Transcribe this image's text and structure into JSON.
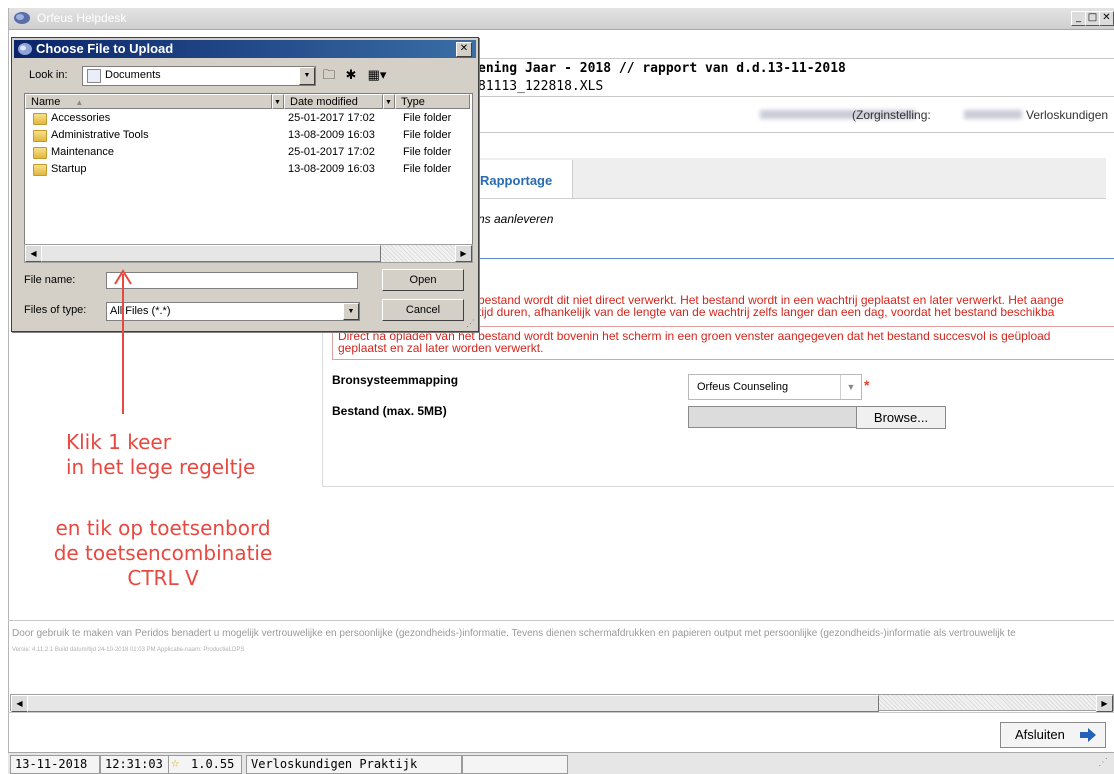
{
  "window": {
    "title": "Orfeus Helpdesk",
    "controls": [
      "_",
      "□",
      "✕"
    ]
  },
  "report": {
    "title_line": "ening Jaar - 2018 // rapport van d.d.13-11-2018",
    "file_line": "81113_122818.XLS",
    "org_prefix": "(Zorginstelling:",
    "org_suffix": "Verloskundigen"
  },
  "tabs": {
    "active_label": "Rapportage"
  },
  "upload": {
    "intro": "ns aanleveren",
    "warning_line1": "bestand wordt dit niet direct verwerkt. Het bestand wordt in een wachtrij geplaatst en later verwerkt. Het aange",
    "warning_line2": "tijd duren, afhankelijk van de lengte van de wachtrij zelfs langer dan een dag, voordat het bestand beschikba",
    "warning_line3": "Direct na opladen van het bestand wordt bovenin het scherm in een groen venster aangegeven dat het bestand succesvol is geüpload",
    "warning_line4": "geplaatst en zal later worden verwerkt.",
    "mapping_label": "Bronsysteemmapping",
    "mapping_value": "Orfeus Counseling",
    "required_mark": "*",
    "file_label": "Bestand (max. 5MB)",
    "browse_label": "Browse..."
  },
  "footer": {
    "privacy_note": "Door gebruik te maken van Peridos benadert u mogelijk vertrouwelijke en persoonlijke (gezondheids-)informatie. Tevens dienen schermafdrukken en papieren output met persoonlijke (gezondheids-)informatie als vertrouwelijk te",
    "version_note": "Versie: 4.11.2.1 Build datum/tijd 24-10-2018 01:03 PM Applicatie-naam: ProductieLDPS"
  },
  "close_button": "Afsluiten",
  "statusbar": {
    "date": "13-11-2018",
    "time": "12:31:03",
    "version": "1.0.55",
    "practice": "Verloskundigen Praktijk"
  },
  "dialog": {
    "title": "Choose File to Upload",
    "look_in_label": "Look in:",
    "look_in_value": "Documents",
    "columns": {
      "name": "Name",
      "date": "Date modified",
      "type": "Type"
    },
    "files": [
      {
        "name": "Accessories",
        "date": "25-01-2017 17:02",
        "type": "File folder"
      },
      {
        "name": "Administrative Tools",
        "date": "13-08-2009 16:03",
        "type": "File folder"
      },
      {
        "name": "Maintenance",
        "date": "25-01-2017 17:02",
        "type": "File folder"
      },
      {
        "name": "Startup",
        "date": "13-08-2009 16:03",
        "type": "File folder"
      }
    ],
    "file_name_label": "File name:",
    "file_name_value": "",
    "files_of_type_label": "Files of type:",
    "files_of_type_value": "All Files (*.*)",
    "open_label": "Open",
    "cancel_label": "Cancel"
  },
  "annotation": {
    "line1": "Klik 1 keer",
    "line2": "in het lege regeltje",
    "line3": "en tik op toetsenbord",
    "line4": "de toetsencombinatie",
    "line5": "CTRL  V",
    "color": "#e8483f"
  }
}
